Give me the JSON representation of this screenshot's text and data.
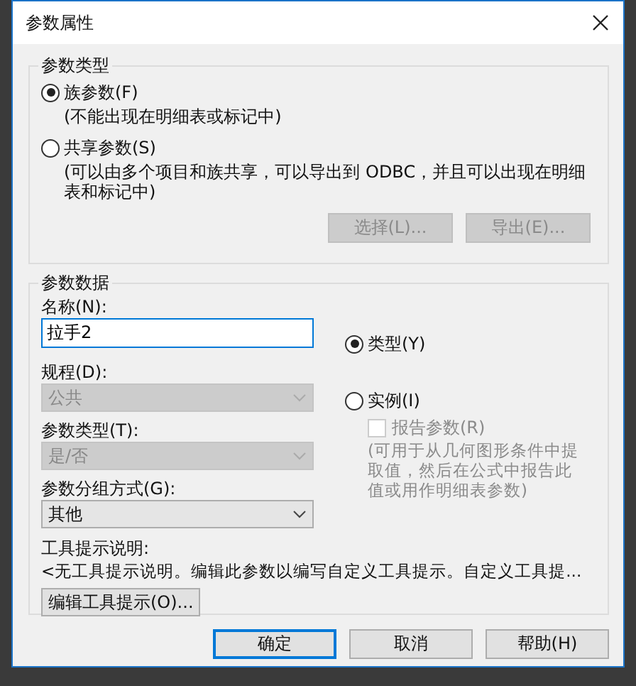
{
  "window": {
    "title": "参数属性"
  },
  "parameter_type_group": {
    "title": "参数类型",
    "options": [
      {
        "label": "族参数(F)",
        "note": "(不能出现在明细表或标记中)",
        "selected": true
      },
      {
        "label": "共享参数(S)",
        "note": "(可以由多个项目和族共享，可以导出到 ODBC，并且可以出现在明细表和标记中)",
        "selected": false
      }
    ],
    "buttons": [
      {
        "label": "选择(L)...",
        "disabled": true
      },
      {
        "label": "导出(E)...",
        "disabled": true
      }
    ]
  },
  "parameter_data_group": {
    "title": "参数数据",
    "name_label": "名称(N):",
    "name_value": "拉手2",
    "dropdowns": [
      {
        "label": "规程(D):",
        "value": "公共",
        "disabled": true
      },
      {
        "label": "参数类型(T):",
        "value": "是/否",
        "disabled": true
      },
      {
        "label": "参数分组方式(G):",
        "value": "其他",
        "disabled": false
      }
    ],
    "scope_options": [
      {
        "label": "类型(Y)",
        "selected": true
      },
      {
        "label": "实例(I)",
        "selected": false
      }
    ],
    "report_checkbox": {
      "label": "报告参数(R)",
      "checked": false,
      "disabled": true
    },
    "report_note": "(可用于从几何图形条件中提取值，然后在公式中报告此值或用作明细表参数)",
    "tooltip_label": "工具提示说明:",
    "tooltip_text": "<无工具提示说明。编辑此参数以编写自定义工具提示。自定义工具提...",
    "edit_tooltip_button": "编辑工具提示(O)..."
  },
  "footer_buttons": [
    {
      "label": "确定",
      "default": true
    },
    {
      "label": "取消",
      "default": false
    },
    {
      "label": "帮助(H)",
      "default": false
    }
  ]
}
